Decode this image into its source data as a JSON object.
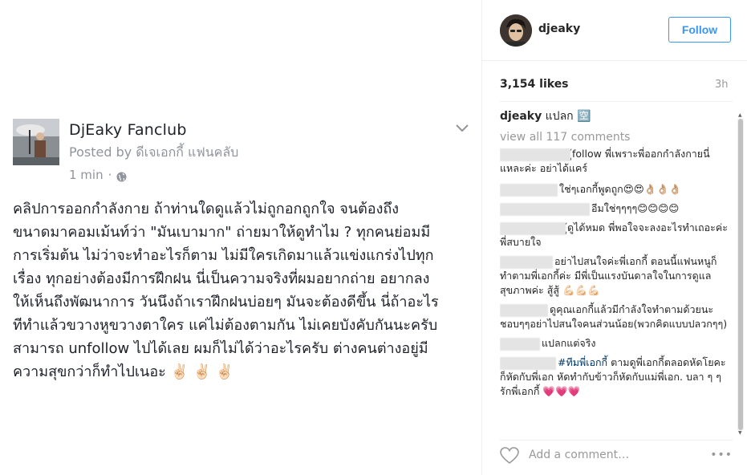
{
  "fb_post": {
    "page_name": "DjEaky Fanclub",
    "posted_by": "Posted by ดีเจเอกกี้ แฟนคลับ",
    "time": "1 min",
    "separator": "·",
    "body": "คลิปการออกกำลังกาย ถ้าท่านใดดูแล้วไม่ถูกอกถูกใจ จนต้องถึง\nขนาดมาคอมเม้นท์ว่า \"มันเบามาก\" ถ่ายมาให้ดูทำไม ? ทุกคนย่อมมี\nการเริ่มต้น ไม่ว่าจะทำอะไรก็ตาม ไม่มีใครเกิดมาแล้วแข่งแกร่งไปทุก\nเรื่อง ทุกอย่างต้องมีการฝึกฝน นี่เป็นความจริงที่ผมอยากถ่าย อยากลง\nให้เห็นถึงพัฒนาการ วันนึงถ้าเราฝึกฝนบ่อยๆ มันจะต้องดีขึ้น นี่ถ้าอะไร\nทีทำแล้วขวางหูขวางตาใคร แค่ไม่ต้องตามกัน ไม่เคยบังคับกันนะครับ\nสามารถ unfollow ไปได้เลย ผมก็ไม่ได้ว่าอะไรครับ ต่างคนต่างอยู่มี\nความสุขกว่าก็ทำไปเนอะ ✌🏻 ✌🏻 ✌🏻"
  },
  "sidebar": {
    "username": "djeaky",
    "follow_label": "Follow",
    "likes": "3,154 likes",
    "time_ago": "3h",
    "caption_user": "djeaky",
    "caption_text": "แปลก 🈳",
    "view_all": "view all 117 comments",
    "comments": [
      {
        "text": "ู้follow พี่เพราะพี่ออกกำลังกายนี่แหละค่ะ อย่าได้แคร์"
      },
      {
        "text": "ใช่ๆเอกกี้พูดถูก😍😍👌🏼👌🏼👌🏼"
      },
      {
        "text": "อีมใช่ๆๆๆๆ😊😊😊😊"
      },
      {
        "text": "ู้ดูได้หมด พี่พอใจจะลงอะไรทำเถอะค่ะ พี่สบายใจ"
      },
      {
        "text": "อย่าไปสนใจค่ะพี่เอกกี้ ตอนนี้แฟนหนูก็ทำตามพี่เอกกี้ค่ะ มีพี่เป็นแรงบันดาลใจในการดูแลสุขภาพค่ะ สู้สู้ 💪🏻💪🏻💪🏻"
      },
      {
        "text": "ดูคุณเอกกี้แล้วมีกำลังใจทำตามด้วยนะชอบๆๆอย่าไปสนใจคนส่วนน้อย(พวกคิดแบบปลวกๆๆ)"
      },
      {
        "text": "แปลกแต่จริง"
      },
      {
        "hashtag": "#ทีมพี่เอกกี้",
        "text": " ตามดูพี่เอกกี้ตลอดหัดโยคะก็หัดกับพี่เอก หัดทำกับข้าวก็หัดกับแม่พี่เอก. บลา ๆ ๆ รักพี่เอกกี้ 💗💗💗"
      }
    ],
    "add_comment_placeholder": "Add a comment…",
    "more_label": "•••"
  },
  "colors": {
    "follow_blue": "#3897f0",
    "muted": "#999999",
    "fb_text": "#1d2129",
    "fb_muted": "#90949c"
  }
}
